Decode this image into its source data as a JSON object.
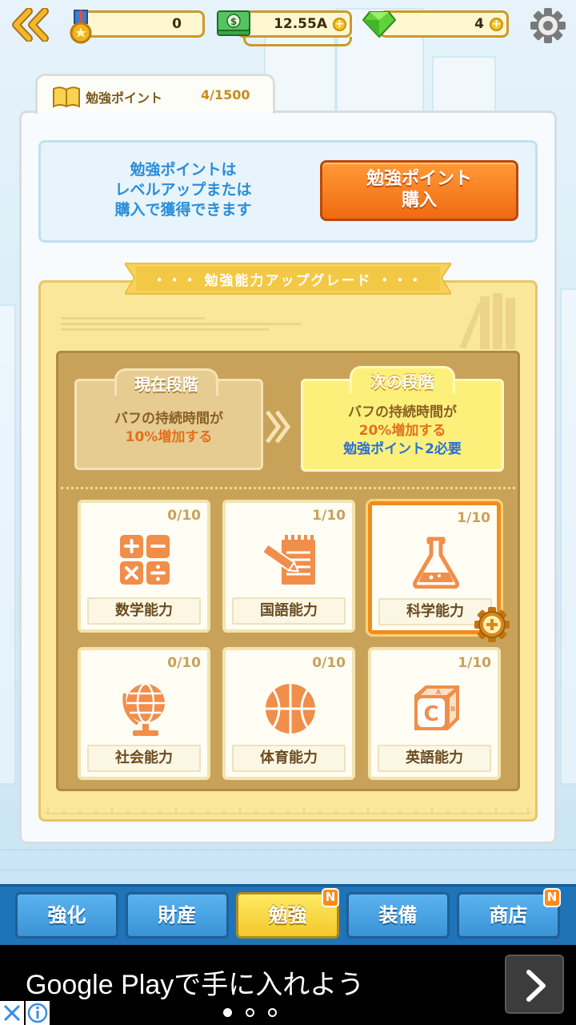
{
  "topbar": {
    "medals": "0",
    "money": "12.55A",
    "gems": "4"
  },
  "study_points": {
    "title": "勉強ポイント",
    "count": "4/1500",
    "info": "勉強ポイントは\nレベルアップまたは\n購入で獲得できます",
    "buy_button": "勉強ポイント\n購入"
  },
  "upgrade": {
    "ribbon": "・・・ 勉強能力アップグレード ・・・",
    "current_stage": {
      "title": "現在段階",
      "line1": "バフの持続時間が",
      "line2": "10%増加する"
    },
    "next_stage": {
      "title": "次の段階",
      "line1": "バフの持続時間が",
      "line2": "20%増加する",
      "line3": "勉強ポイント2必要"
    },
    "skills": [
      {
        "label": "数学能力",
        "count": "0/10",
        "icon": "calculator-icon"
      },
      {
        "label": "国語能力",
        "count": "1/10",
        "icon": "notebook-pencil-icon"
      },
      {
        "label": "科学能力",
        "count": "1/10",
        "icon": "flask-icon",
        "selected": true
      },
      {
        "label": "社会能力",
        "count": "0/10",
        "icon": "globe-icon"
      },
      {
        "label": "体育能力",
        "count": "0/10",
        "icon": "basketball-icon"
      },
      {
        "label": "英語能力",
        "count": "1/10",
        "icon": "abc-block-icon"
      }
    ]
  },
  "nav": {
    "items": [
      {
        "label": "強化"
      },
      {
        "label": "財産"
      },
      {
        "label": "勉強",
        "active": true,
        "badge": "N"
      },
      {
        "label": "装備"
      },
      {
        "label": "商店",
        "badge": "N"
      }
    ]
  },
  "ad": {
    "text": "Google Playで手に入れよう"
  },
  "colors": {
    "accent_orange": "#f06a10",
    "info_blue": "#2b8ed8",
    "nav_blue": "#3a93d6",
    "nav_active": "#f4c82c"
  }
}
